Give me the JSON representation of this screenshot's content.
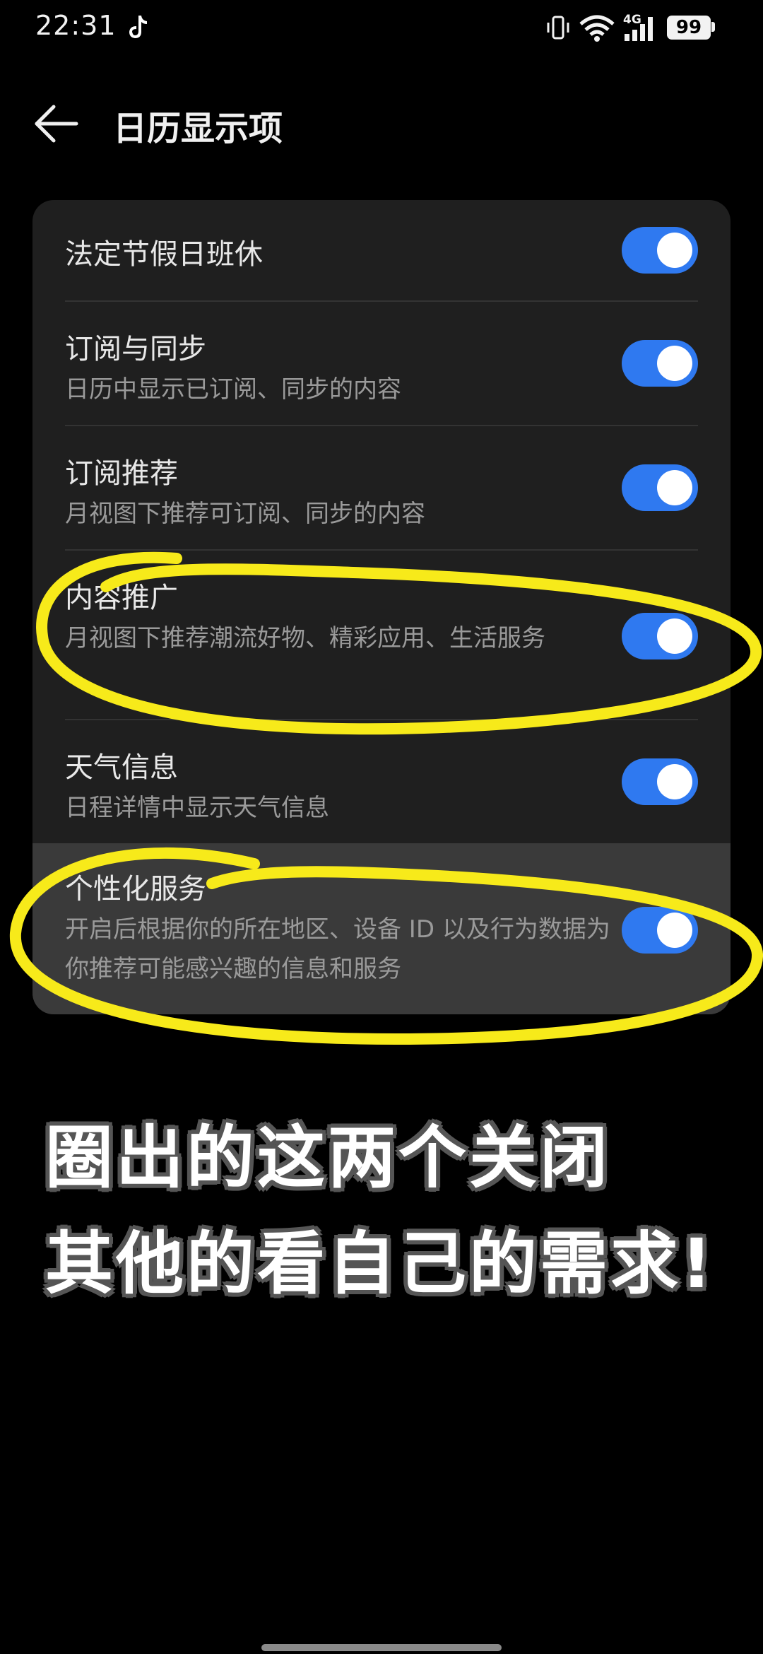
{
  "status_bar": {
    "time": "22:31",
    "network": "4G",
    "battery": "99"
  },
  "header": {
    "title": "日历显示项"
  },
  "settings": [
    {
      "title": "法定节假日班休",
      "description": "",
      "enabled": true
    },
    {
      "title": "订阅与同步",
      "description": "日历中显示已订阅、同步的内容",
      "enabled": true
    },
    {
      "title": "订阅推荐",
      "description": "月视图下推荐可订阅、同步的内容",
      "enabled": true
    },
    {
      "title": "内容推广",
      "description": "月视图下推荐潮流好物、精彩应用、生活服务",
      "enabled": true
    },
    {
      "title": "天气信息",
      "description": "日程详情中显示天气信息",
      "enabled": true
    },
    {
      "title": "个性化服务",
      "description": "开启后根据你的所在地区、设备 ID 以及行为数据为你推荐可能感兴趣的信息和服务",
      "enabled": true
    }
  ],
  "annotation": {
    "line1": "圈出的这两个关闭",
    "line2": "其他的看自己的需求!",
    "highlight_color": "#f7ea1a"
  },
  "colors": {
    "toggle_on": "#2f79f0",
    "card_bg": "#1f1f1f",
    "page_bg": "#000000"
  }
}
